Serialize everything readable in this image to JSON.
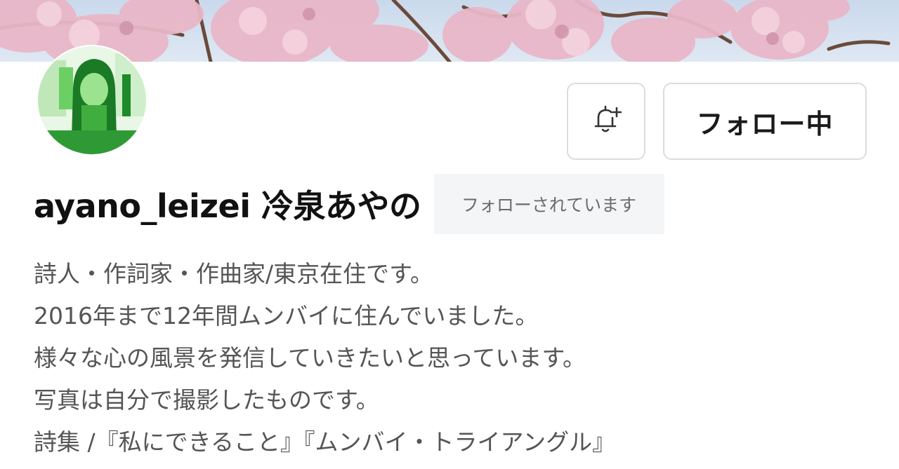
{
  "profile": {
    "username": "ayano_leizei 冷泉あやの",
    "followed_badge": "フォローされています"
  },
  "actions": {
    "notify_icon": "bell-plus-icon",
    "follow_label": "フォロー中"
  },
  "bio": {
    "lines": [
      "詩人・作詞家・作曲家/東京在住です。",
      "2016年まで12年間ムンバイに住んでいました。",
      "様々な心の風景を発信していきたいと思っています。",
      "写真は自分で撮影したものです。",
      "詩集 /『私にできること』『ムンバイ・トライアングル』"
    ]
  },
  "colors": {
    "avatar_accent": "#22c55e",
    "blossom": "#e9b7c8",
    "sky": "#c9d9ec",
    "badge_bg": "#f3f5f6",
    "button_border": "#dcdcdc"
  }
}
